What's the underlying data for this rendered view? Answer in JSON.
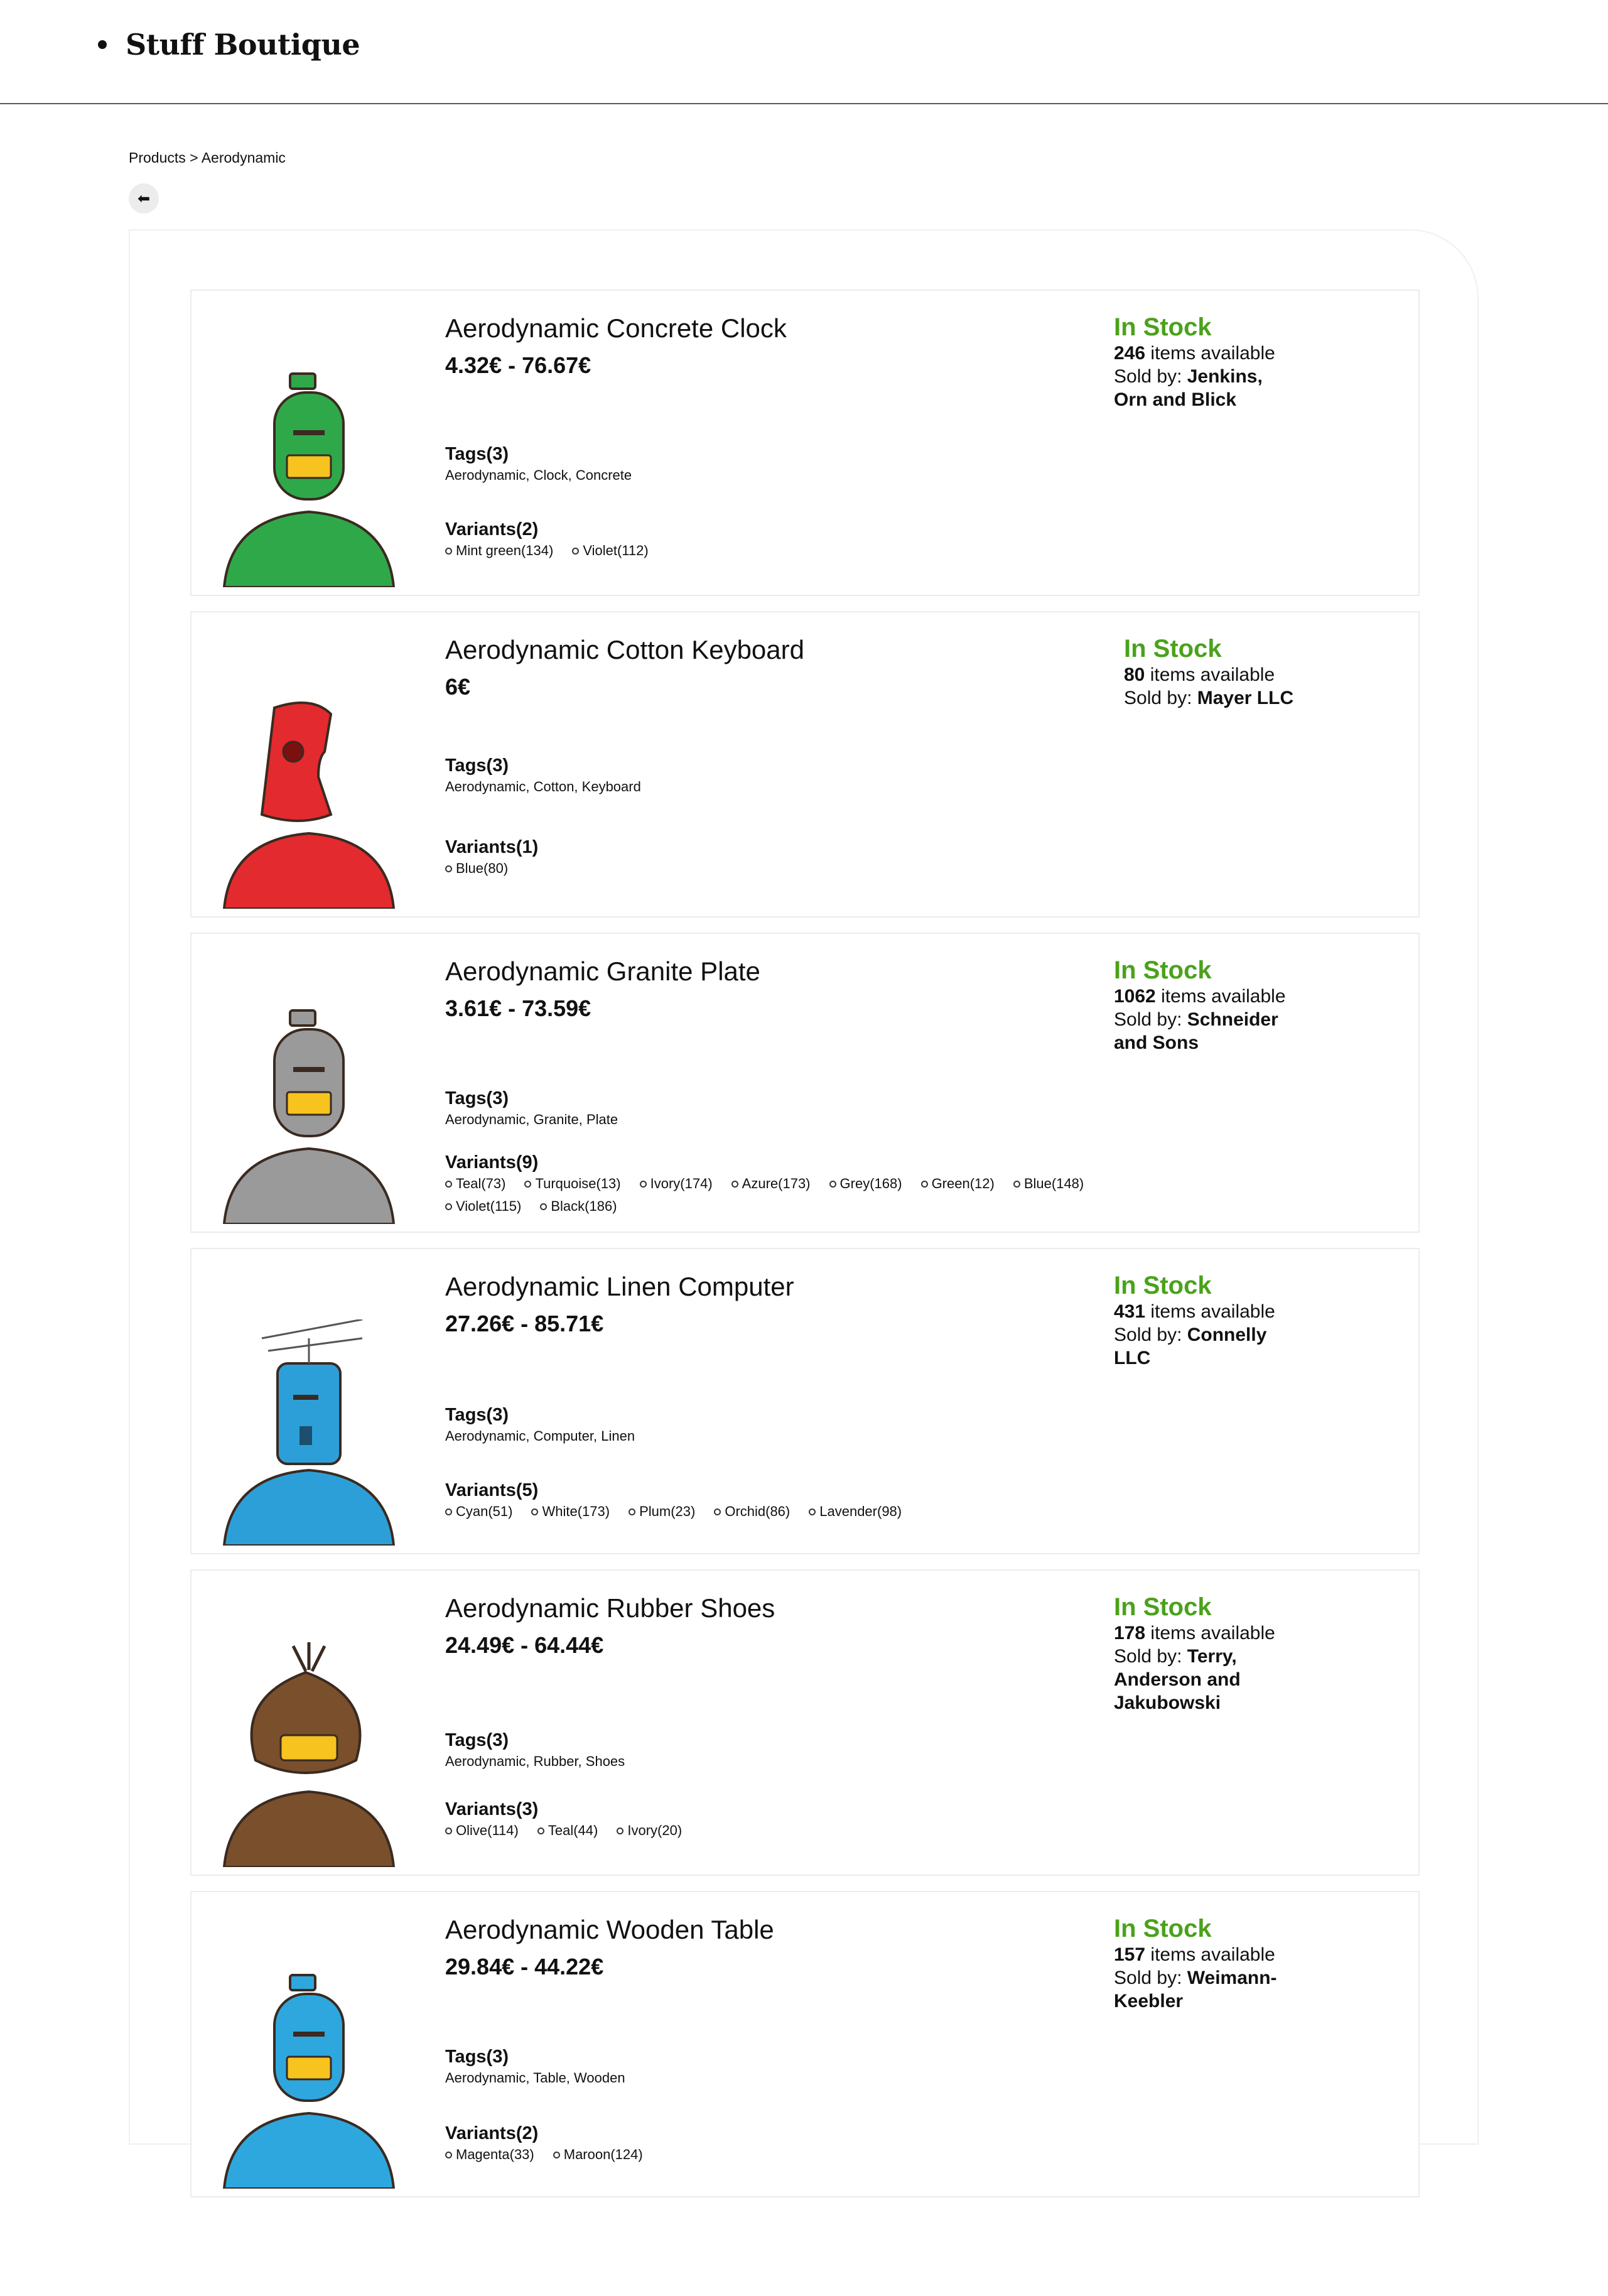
{
  "site": {
    "brand": "Stuff Boutique"
  },
  "breadcrumb": {
    "path": "Products > Aerodynamic"
  },
  "colors": {
    "in_stock": "#4aa21c"
  },
  "products": [
    {
      "title": "Aerodynamic Concrete Clock",
      "price": "4.32€ - 76.67€",
      "tags_heading": "Tags(3)",
      "tags": "Aerodynamic, Clock, Concrete",
      "variants_heading": "Variants(2)",
      "variants": [
        "Mint green(134)",
        "Violet(112)"
      ],
      "status": "In Stock",
      "count": "246",
      "avail_suffix": " items available",
      "sold_by_label": "Sold by: ",
      "seller": "Jenkins, Orn and Blick",
      "robot_color": "#2fa84a",
      "robot_icon": "robot-avatar-icon"
    },
    {
      "title": "Aerodynamic Cotton Keyboard",
      "price": "6€",
      "tags_heading": "Tags(3)",
      "tags": "Aerodynamic, Cotton, Keyboard",
      "variants_heading": "Variants(1)",
      "variants": [
        "Blue(80)"
      ],
      "status": "In Stock",
      "count": "80",
      "avail_suffix": " items available",
      "sold_by_label": "Sold by: ",
      "seller": "Mayer LLC",
      "robot_color": "#e32a2f",
      "robot_icon": "robot-avatar-icon"
    },
    {
      "title": "Aerodynamic Granite Plate",
      "price": "3.61€ - 73.59€",
      "tags_heading": "Tags(3)",
      "tags": "Aerodynamic, Granite, Plate",
      "variants_heading": "Variants(9)",
      "variants": [
        "Teal(73)",
        "Turquoise(13)",
        "Ivory(174)",
        "Azure(173)",
        "Grey(168)",
        "Green(12)",
        "Blue(148)",
        "Violet(115)",
        "Black(186)"
      ],
      "status": "In Stock",
      "count": "1062",
      "avail_suffix": " items available",
      "sold_by_label": "Sold by: ",
      "seller": "Schneider and Sons",
      "robot_color": "#9a9a9a",
      "robot_icon": "robot-avatar-icon"
    },
    {
      "title": "Aerodynamic Linen Computer",
      "price": "27.26€ - 85.71€",
      "tags_heading": "Tags(3)",
      "tags": "Aerodynamic, Computer, Linen",
      "variants_heading": "Variants(5)",
      "variants": [
        "Cyan(51)",
        "White(173)",
        "Plum(23)",
        "Orchid(86)",
        "Lavender(98)"
      ],
      "status": "In Stock",
      "count": "431",
      "avail_suffix": " items available",
      "sold_by_label": "Sold by: ",
      "seller": "Connelly LLC",
      "robot_color": "#2d9fd8",
      "robot_icon": "robot-avatar-icon"
    },
    {
      "title": "Aerodynamic Rubber Shoes",
      "price": "24.49€ - 64.44€",
      "tags_heading": "Tags(3)",
      "tags": "Aerodynamic, Rubber, Shoes",
      "variants_heading": "Variants(3)",
      "variants": [
        "Olive(114)",
        "Teal(44)",
        "Ivory(20)"
      ],
      "status": "In Stock",
      "count": "178",
      "avail_suffix": " items available",
      "sold_by_label": "Sold by: ",
      "seller": "Terry, Anderson and Jakubowski",
      "robot_color": "#7a4f2c",
      "robot_icon": "robot-avatar-icon"
    },
    {
      "title": "Aerodynamic Wooden Table",
      "price": "29.84€ - 44.22€",
      "tags_heading": "Tags(3)",
      "tags": "Aerodynamic, Table, Wooden",
      "variants_heading": "Variants(2)",
      "variants": [
        "Magenta(33)",
        "Maroon(124)"
      ],
      "status": "In Stock",
      "count": "157",
      "avail_suffix": " items available",
      "sold_by_label": "Sold by: ",
      "seller": "Weimann-Keebler",
      "robot_color": "#2ea7de",
      "robot_icon": "robot-avatar-icon"
    }
  ]
}
